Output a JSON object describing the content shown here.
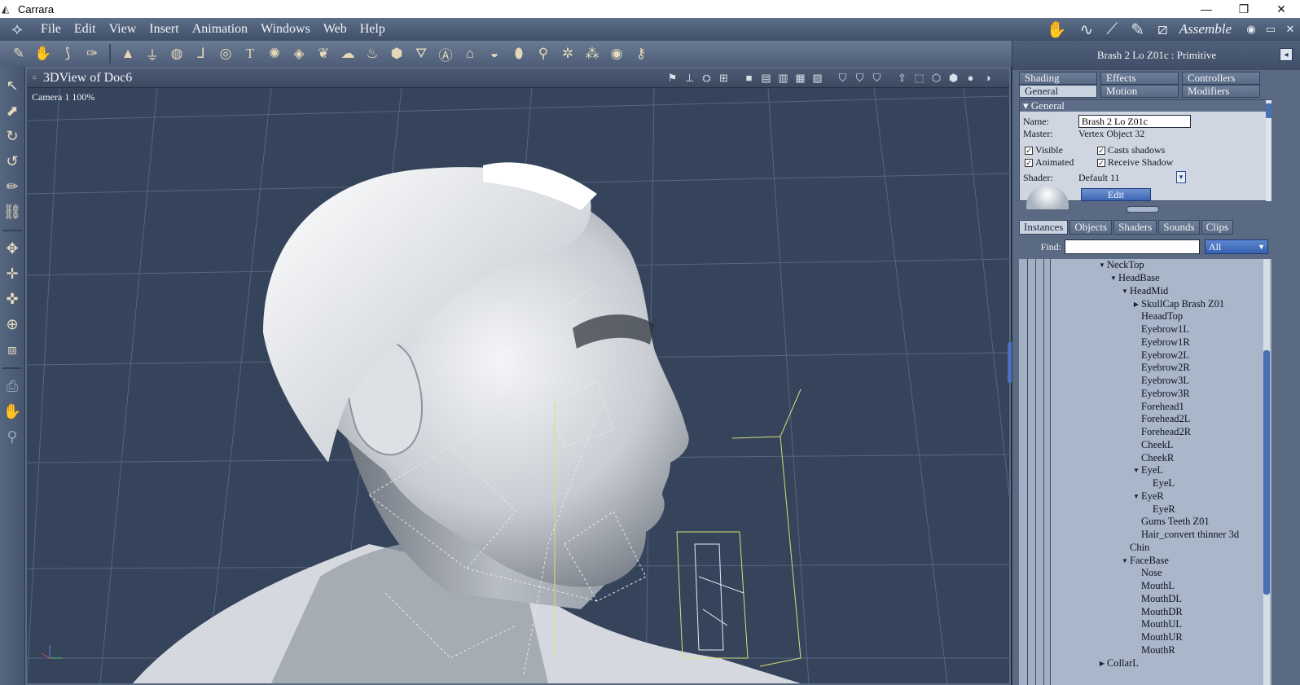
{
  "window": {
    "title": "Carrara",
    "controls": {
      "minimize": "—",
      "restore": "❐",
      "close": "✕"
    }
  },
  "menu": {
    "items": [
      "File",
      "Edit",
      "View",
      "Insert",
      "Animation",
      "Windows",
      "Web",
      "Help"
    ]
  },
  "room": {
    "label": "Assemble",
    "icons": [
      "assemble-room-icon",
      "model-room-icon",
      "storyboard-room-icon",
      "texture-room-icon",
      "render-room-icon"
    ]
  },
  "toolbar": {
    "tools": [
      "tool-1",
      "tool-2",
      "tool-3",
      "tool-4",
      "tool-5",
      "tool-6",
      "tool-7",
      "tool-8",
      "tool-9",
      "tool-10",
      "tool-11",
      "tool-12",
      "tool-13",
      "tool-14",
      "tool-15",
      "tool-16",
      "tool-17",
      "tool-18",
      "tool-19",
      "tool-20",
      "tool-21",
      "tool-22",
      "tool-23",
      "tool-24",
      "tool-25",
      "tool-26",
      "tool-27",
      "tool-28"
    ]
  },
  "viewport": {
    "title": "3DView of Doc6",
    "camera_label": "Camera 1 100%",
    "axis_label": "z y"
  },
  "properties": {
    "header": "Brash 2 Lo Z01c : Primitive",
    "tabs_row1": [
      "Shading",
      "Effects",
      "Controllers"
    ],
    "tabs_row2": [
      "General",
      "Motion",
      "Modifiers"
    ],
    "active_tab": "General",
    "section_title": "General",
    "name_label": "Name:",
    "name_value": "Brash 2 Lo Z01c",
    "master_label": "Master:",
    "master_value": "Vertex Object 32",
    "checkboxes": {
      "visible": "Visible",
      "casts_shadows": "Casts shadows",
      "animated": "Animated",
      "receive_shadow": "Receive Shadow"
    },
    "shader_label": "Shader:",
    "shader_value": "Default 11",
    "edit_button": "Edit"
  },
  "browser": {
    "tabs": [
      "Instances",
      "Objects",
      "Shaders",
      "Sounds",
      "Clips"
    ],
    "active_tab": "Instances",
    "find_label": "Find:",
    "find_value": "",
    "filter_value": "All",
    "tree": [
      {
        "label": "NeckTop",
        "indent": 0,
        "twisty": "open"
      },
      {
        "label": "HeadBase",
        "indent": 1,
        "twisty": "open"
      },
      {
        "label": "HeadMid",
        "indent": 2,
        "twisty": "open"
      },
      {
        "label": "SkullCap Brash Z01",
        "indent": 3,
        "twisty": "closed"
      },
      {
        "label": "HeaadTop",
        "indent": 3,
        "twisty": "none"
      },
      {
        "label": "Eyebrow1L",
        "indent": 3,
        "twisty": "none"
      },
      {
        "label": "Eyebrow1R",
        "indent": 3,
        "twisty": "none"
      },
      {
        "label": "Eyebrow2L",
        "indent": 3,
        "twisty": "none"
      },
      {
        "label": "Eyebrow2R",
        "indent": 3,
        "twisty": "none"
      },
      {
        "label": "Eyebrow3L",
        "indent": 3,
        "twisty": "none"
      },
      {
        "label": "Eyebrow3R",
        "indent": 3,
        "twisty": "none"
      },
      {
        "label": "Forehead1",
        "indent": 3,
        "twisty": "none"
      },
      {
        "label": "Forehead2L",
        "indent": 3,
        "twisty": "none"
      },
      {
        "label": "Forehead2R",
        "indent": 3,
        "twisty": "none"
      },
      {
        "label": "CheekL",
        "indent": 3,
        "twisty": "none"
      },
      {
        "label": "CheekR",
        "indent": 3,
        "twisty": "none"
      },
      {
        "label": "EyeL",
        "indent": 3,
        "twisty": "open"
      },
      {
        "label": "EyeL",
        "indent": 4,
        "twisty": "none"
      },
      {
        "label": "EyeR",
        "indent": 3,
        "twisty": "open"
      },
      {
        "label": "EyeR",
        "indent": 4,
        "twisty": "none"
      },
      {
        "label": "Gums Teeth Z01",
        "indent": 3,
        "twisty": "none"
      },
      {
        "label": "Hair_convert thinner 3d",
        "indent": 3,
        "twisty": "none"
      },
      {
        "label": "Chin",
        "indent": 2,
        "twisty": "none"
      },
      {
        "label": "FaceBase",
        "indent": 2,
        "twisty": "open"
      },
      {
        "label": "Nose",
        "indent": 3,
        "twisty": "none"
      },
      {
        "label": "MouthL",
        "indent": 3,
        "twisty": "none"
      },
      {
        "label": "MouthDL",
        "indent": 3,
        "twisty": "none"
      },
      {
        "label": "MouthDR",
        "indent": 3,
        "twisty": "none"
      },
      {
        "label": "MouthUL",
        "indent": 3,
        "twisty": "none"
      },
      {
        "label": "MouthUR",
        "indent": 3,
        "twisty": "none"
      },
      {
        "label": "MouthR",
        "indent": 3,
        "twisty": "none"
      },
      {
        "label": "CollarL",
        "indent": 0,
        "twisty": "closed"
      }
    ]
  },
  "colors": {
    "viewport_bg": "#34425a",
    "grid": "#5a6a84",
    "bounding_box": "#d8e07a",
    "panel_bg": "#5b6a83",
    "accent_blue": "#3d66b2"
  }
}
